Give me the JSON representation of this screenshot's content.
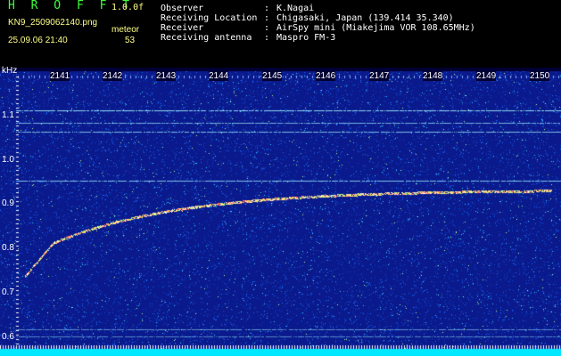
{
  "header": {
    "app_title": "H R O F F T",
    "version": "1.0.0f",
    "filename": "KN9_2509062140.png",
    "mode": "meteor",
    "datetime": "25.09.06 21:40",
    "count": "53"
  },
  "metadata": [
    {
      "label": "Observer",
      "value": "K.Nagai"
    },
    {
      "label": "Receiving Location",
      "value": "Chigasaki, Japan (139.414 35.340)"
    },
    {
      "label": "Receiver",
      "value": "AirSpy mini (Miakejima VOR 108.65MHz)"
    },
    {
      "label": "Receiving antenna",
      "value": "Maspro FM-3"
    }
  ],
  "separator": ":",
  "spectrogram": {
    "y_unit": "kHz",
    "y_ticks": [
      "1.1",
      "1.0",
      "0.9",
      "0.8",
      "0.7",
      "0.6"
    ],
    "x_ticks": [
      "2141",
      "2142",
      "2143",
      "2144",
      "2145",
      "2146",
      "2147",
      "2148",
      "2149",
      "2150"
    ],
    "colors": {
      "background": "#0a1a8c",
      "noise": "#1a6cff",
      "trace": "#ffe070",
      "carrier": "#9ef0ff",
      "bottom_strip": "#00e8ff"
    }
  }
}
